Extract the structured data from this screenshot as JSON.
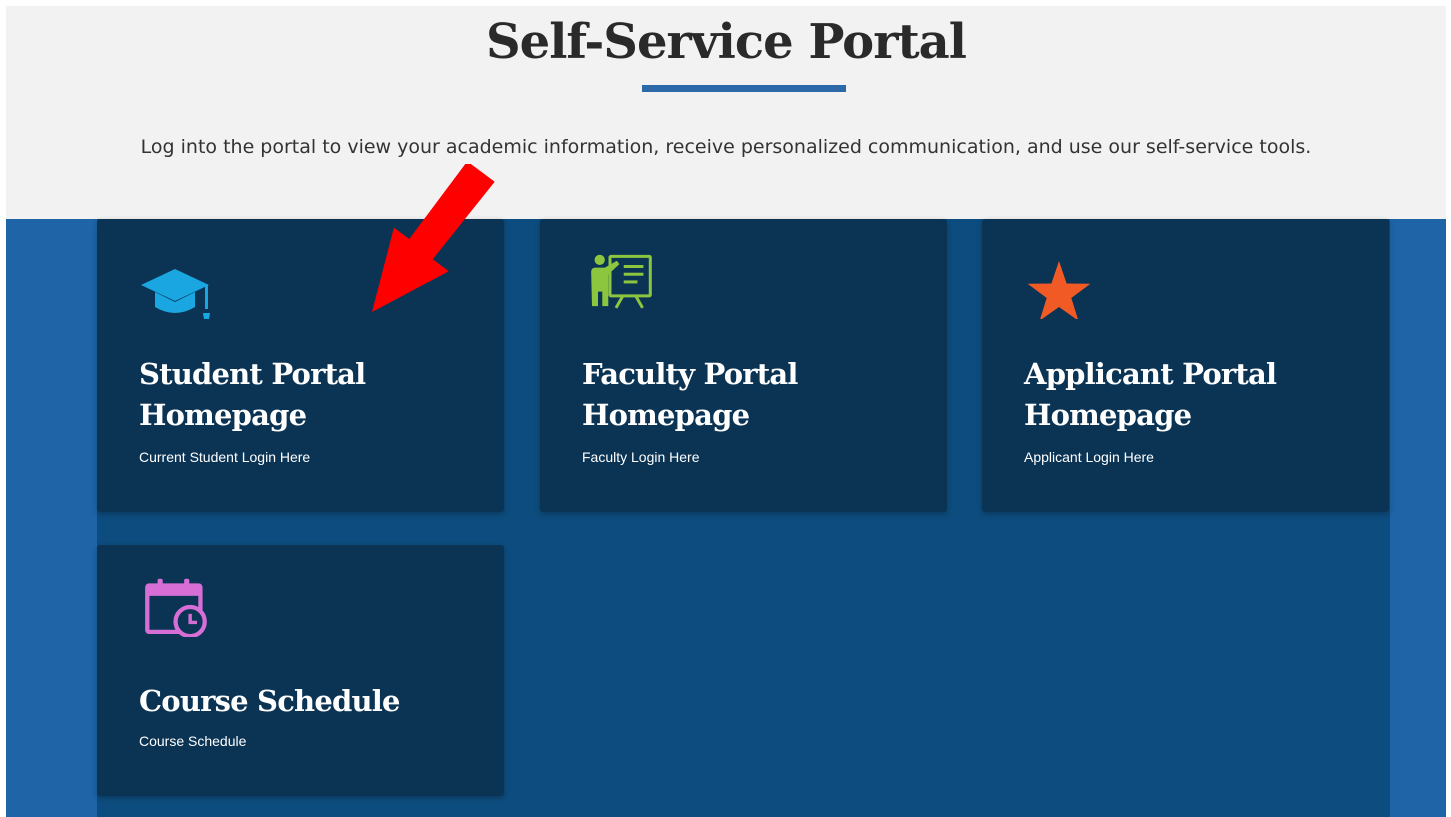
{
  "header": {
    "title": "Self-Service Portal",
    "intro": "Log into the portal to view your academic information, receive personalized communication, and use our self-service tools."
  },
  "cards": [
    {
      "title_line1": "Student Portal",
      "title_line2": "Homepage",
      "subtitle": "Current Student Login Here",
      "icon": "graduation-cap-icon",
      "icon_color": "#1aa6e0"
    },
    {
      "title_line1": "Faculty Portal",
      "title_line2": "Homepage",
      "subtitle": "Faculty Login Here",
      "icon": "teacher-whiteboard-icon",
      "icon_color": "#8cc63f"
    },
    {
      "title_line1": "Applicant Portal",
      "title_line2": "Homepage",
      "subtitle": "Applicant Login Here",
      "icon": "star-icon",
      "icon_color": "#f15a24"
    },
    {
      "title_line1": "Course Schedule",
      "subtitle": "Course Schedule",
      "icon": "calendar-clock-icon",
      "icon_color": "#d66ed6"
    }
  ],
  "annotation": {
    "icon": "red-arrow-icon",
    "color": "#ff0000"
  },
  "colors": {
    "header_bg": "#f2f2f2",
    "accent": "#2d68a8",
    "band": "#1e64a6",
    "card_area": "#0d4c7e",
    "card": "#0a3354"
  }
}
